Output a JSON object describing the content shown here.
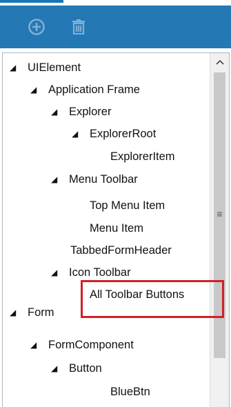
{
  "toolbar": {
    "add_icon": "plus-circle-icon",
    "delete_icon": "trash-icon"
  },
  "tree": {
    "nodes": [
      {
        "label": "UIElement",
        "expanded": true
      },
      {
        "label": "Application Frame",
        "expanded": true
      },
      {
        "label": "Explorer",
        "expanded": true
      },
      {
        "label": "ExplorerRoot",
        "expanded": true
      },
      {
        "label": "ExplorerItem"
      },
      {
        "label": "Menu Toolbar",
        "expanded": true
      },
      {
        "label": "Top Menu Item"
      },
      {
        "label": "Menu Item"
      },
      {
        "label": "TabbedFormHeader"
      },
      {
        "label": "Icon Toolbar",
        "expanded": true
      },
      {
        "label": "All Toolbar Buttons",
        "highlighted": true
      },
      {
        "label": "Form",
        "expanded": true
      },
      {
        "label": "FormComponent",
        "expanded": true
      },
      {
        "label": "Button",
        "expanded": true
      },
      {
        "label": "BlueBtn"
      }
    ]
  },
  "colors": {
    "toolbar_bg": "#2478b4",
    "highlight": "#d21f26"
  }
}
